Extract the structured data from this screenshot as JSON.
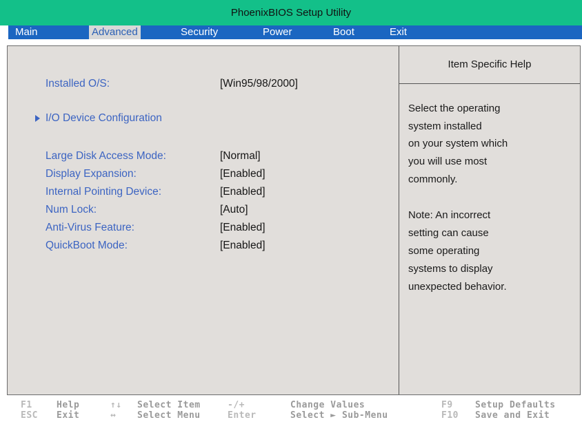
{
  "title": "PhoenixBIOS Setup Utility",
  "menu": {
    "items": [
      "Main",
      "Advanced",
      "Security",
      "Power",
      "Boot",
      "Exit"
    ],
    "active": "Advanced"
  },
  "settings": [
    {
      "label": "Installed O/S:",
      "value": "[Win95/98/2000]"
    },
    {
      "label": "Large  Disk  Access  Mode:",
      "value": "[Normal]"
    },
    {
      "label": "Display Expansion:",
      "value": "[Enabled]"
    },
    {
      "label": "Internal  Pointing  Device:",
      "value": "[Enabled]"
    },
    {
      "label": "Num  Lock:",
      "value": "[Auto]"
    },
    {
      "label": "Anti-Virus Feature:",
      "value": "[Enabled]"
    },
    {
      "label": "QuickBoot Mode:",
      "value": "[Enabled]"
    }
  ],
  "submenu": {
    "label": "I/O Device Configuration",
    "icon": "right-triangle-icon"
  },
  "help": {
    "header": "Item  Specific  Help",
    "lines": [
      "Select the operating",
      "system installed",
      "on your system which",
      "you will use most",
      "commonly.",
      "Note: An incorrect",
      "setting can cause",
      "some operating",
      "systems to display",
      "unexpected behavior."
    ]
  },
  "footer": {
    "keys": [
      {
        "key": "F1",
        "desc": "Help"
      },
      {
        "key": "ESC",
        "desc": "Exit"
      },
      {
        "key": "↑↓",
        "desc": "Select Item"
      },
      {
        "key": "↔",
        "desc": "Select Menu"
      },
      {
        "key": "-/+",
        "desc": "Change Values"
      },
      {
        "key": "Enter",
        "desc": "Select ► Sub-Menu"
      },
      {
        "key": "F9",
        "desc": "Setup Defaults"
      },
      {
        "key": "F10",
        "desc": "Save and Exit"
      }
    ]
  },
  "colors": {
    "title_bar": "#13c089",
    "menu_bar": "#1b66c1",
    "panel": "#e1dedb",
    "label_blue": "#3c64c2"
  }
}
